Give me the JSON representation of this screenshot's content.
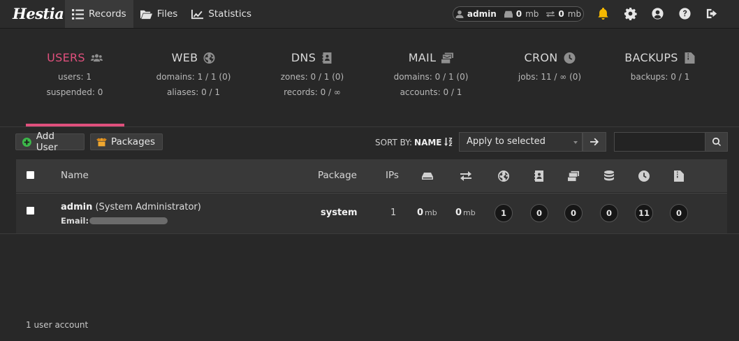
{
  "app": {
    "logo_text": "Hestia"
  },
  "nav": [
    {
      "label": "Records",
      "icon": "list-icon",
      "active": true
    },
    {
      "label": "Files",
      "icon": "folder-open-icon",
      "active": false
    },
    {
      "label": "Statistics",
      "icon": "chart-line-icon",
      "active": false
    }
  ],
  "usage": {
    "user": "admin",
    "disk_value": "0",
    "disk_unit": "mb",
    "bw_value": "0",
    "bw_unit": "mb"
  },
  "top_icons": [
    "bell-icon",
    "gear-icon",
    "user-circle-icon",
    "help-icon",
    "logout-icon"
  ],
  "stats": [
    {
      "title": "USERS",
      "icon": "users-icon",
      "line1": "users: 1",
      "line2": "suspended: 0",
      "active": true
    },
    {
      "title": "WEB",
      "icon": "globe-icon",
      "line1": "domains: 1 / 1 (0)",
      "line2": "aliases: 0 / 1"
    },
    {
      "title": "DNS",
      "icon": "address-book-icon",
      "line1": "zones: 0 / 1 (0)",
      "line2": "records: 0 / ∞"
    },
    {
      "title": "MAIL",
      "icon": "mail-bulk-icon",
      "line1": "domains: 0 / 1 (0)",
      "line2": "accounts: 0 / 1"
    },
    {
      "title": "CRON",
      "icon": "clock-icon",
      "line1": "jobs: 11 / ∞ (0)",
      "line2": ""
    },
    {
      "title": "BACKUPS",
      "icon": "file-zipper-icon",
      "line1": "backups: 0 / 1",
      "line2": ""
    }
  ],
  "toolbar": {
    "add_user": "Add User",
    "packages": "Packages",
    "sort_by": "SORT BY:",
    "sort_field": "NAME",
    "bulk_action": "Apply to selected",
    "search_value": ""
  },
  "table": {
    "headers": {
      "name": "Name",
      "package": "Package",
      "ips": "IPs"
    },
    "header_icons": [
      "hdd-icon",
      "transfer-icon",
      "globe-icon",
      "address-book-icon",
      "mail-bulk-icon",
      "database-icon",
      "clock-icon",
      "file-zipper-icon"
    ],
    "rows": [
      {
        "username": "admin",
        "fullname": " (System Administrator)",
        "email_label": "Email:",
        "package": "system",
        "ips": "1",
        "disk_value": "0",
        "disk_unit": "mb",
        "bw_value": "0",
        "bw_unit": "mb",
        "counts": [
          "1",
          "0",
          "0",
          "0",
          "11",
          "0"
        ]
      }
    ]
  },
  "footer": {
    "text": "1 user account"
  },
  "colors": {
    "accent": "#e0507d",
    "background": "#282828",
    "bell": "#f5b800",
    "add_icon": "#3cb94a",
    "packages_icon": "#f0a830"
  }
}
